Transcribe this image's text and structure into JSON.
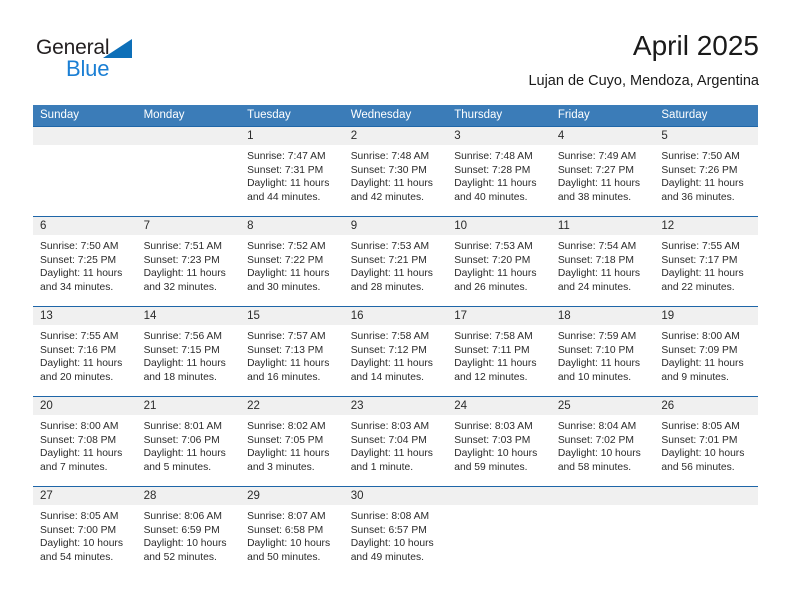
{
  "brand": {
    "name_dark": "General",
    "name_light": "Blue",
    "icon": "triangle-logo-mark",
    "color_dark": "#231f20",
    "color_light": "#1b7fd4"
  },
  "header": {
    "title": "April 2025",
    "subtitle": "Lujan de Cuyo, Mendoza, Argentina"
  },
  "theme": {
    "header_bg": "#3b7cb8",
    "header_text": "#ffffff",
    "row_rule": "#1f66a8",
    "daynum_band": "#f0f0f0",
    "body_text": "#2b2b2b"
  },
  "calendar": {
    "weekday_headers": [
      "Sunday",
      "Monday",
      "Tuesday",
      "Wednesday",
      "Thursday",
      "Friday",
      "Saturday"
    ],
    "weeks": [
      [
        {
          "day": "",
          "lines": []
        },
        {
          "day": "",
          "lines": []
        },
        {
          "day": "1",
          "lines": [
            "Sunrise: 7:47 AM",
            "Sunset: 7:31 PM",
            "Daylight: 11 hours",
            "and 44 minutes."
          ]
        },
        {
          "day": "2",
          "lines": [
            "Sunrise: 7:48 AM",
            "Sunset: 7:30 PM",
            "Daylight: 11 hours",
            "and 42 minutes."
          ]
        },
        {
          "day": "3",
          "lines": [
            "Sunrise: 7:48 AM",
            "Sunset: 7:28 PM",
            "Daylight: 11 hours",
            "and 40 minutes."
          ]
        },
        {
          "day": "4",
          "lines": [
            "Sunrise: 7:49 AM",
            "Sunset: 7:27 PM",
            "Daylight: 11 hours",
            "and 38 minutes."
          ]
        },
        {
          "day": "5",
          "lines": [
            "Sunrise: 7:50 AM",
            "Sunset: 7:26 PM",
            "Daylight: 11 hours",
            "and 36 minutes."
          ]
        }
      ],
      [
        {
          "day": "6",
          "lines": [
            "Sunrise: 7:50 AM",
            "Sunset: 7:25 PM",
            "Daylight: 11 hours",
            "and 34 minutes."
          ]
        },
        {
          "day": "7",
          "lines": [
            "Sunrise: 7:51 AM",
            "Sunset: 7:23 PM",
            "Daylight: 11 hours",
            "and 32 minutes."
          ]
        },
        {
          "day": "8",
          "lines": [
            "Sunrise: 7:52 AM",
            "Sunset: 7:22 PM",
            "Daylight: 11 hours",
            "and 30 minutes."
          ]
        },
        {
          "day": "9",
          "lines": [
            "Sunrise: 7:53 AM",
            "Sunset: 7:21 PM",
            "Daylight: 11 hours",
            "and 28 minutes."
          ]
        },
        {
          "day": "10",
          "lines": [
            "Sunrise: 7:53 AM",
            "Sunset: 7:20 PM",
            "Daylight: 11 hours",
            "and 26 minutes."
          ]
        },
        {
          "day": "11",
          "lines": [
            "Sunrise: 7:54 AM",
            "Sunset: 7:18 PM",
            "Daylight: 11 hours",
            "and 24 minutes."
          ]
        },
        {
          "day": "12",
          "lines": [
            "Sunrise: 7:55 AM",
            "Sunset: 7:17 PM",
            "Daylight: 11 hours",
            "and 22 minutes."
          ]
        }
      ],
      [
        {
          "day": "13",
          "lines": [
            "Sunrise: 7:55 AM",
            "Sunset: 7:16 PM",
            "Daylight: 11 hours",
            "and 20 minutes."
          ]
        },
        {
          "day": "14",
          "lines": [
            "Sunrise: 7:56 AM",
            "Sunset: 7:15 PM",
            "Daylight: 11 hours",
            "and 18 minutes."
          ]
        },
        {
          "day": "15",
          "lines": [
            "Sunrise: 7:57 AM",
            "Sunset: 7:13 PM",
            "Daylight: 11 hours",
            "and 16 minutes."
          ]
        },
        {
          "day": "16",
          "lines": [
            "Sunrise: 7:58 AM",
            "Sunset: 7:12 PM",
            "Daylight: 11 hours",
            "and 14 minutes."
          ]
        },
        {
          "day": "17",
          "lines": [
            "Sunrise: 7:58 AM",
            "Sunset: 7:11 PM",
            "Daylight: 11 hours",
            "and 12 minutes."
          ]
        },
        {
          "day": "18",
          "lines": [
            "Sunrise: 7:59 AM",
            "Sunset: 7:10 PM",
            "Daylight: 11 hours",
            "and 10 minutes."
          ]
        },
        {
          "day": "19",
          "lines": [
            "Sunrise: 8:00 AM",
            "Sunset: 7:09 PM",
            "Daylight: 11 hours",
            "and 9 minutes."
          ]
        }
      ],
      [
        {
          "day": "20",
          "lines": [
            "Sunrise: 8:00 AM",
            "Sunset: 7:08 PM",
            "Daylight: 11 hours",
            "and 7 minutes."
          ]
        },
        {
          "day": "21",
          "lines": [
            "Sunrise: 8:01 AM",
            "Sunset: 7:06 PM",
            "Daylight: 11 hours",
            "and 5 minutes."
          ]
        },
        {
          "day": "22",
          "lines": [
            "Sunrise: 8:02 AM",
            "Sunset: 7:05 PM",
            "Daylight: 11 hours",
            "and 3 minutes."
          ]
        },
        {
          "day": "23",
          "lines": [
            "Sunrise: 8:03 AM",
            "Sunset: 7:04 PM",
            "Daylight: 11 hours",
            "and 1 minute."
          ]
        },
        {
          "day": "24",
          "lines": [
            "Sunrise: 8:03 AM",
            "Sunset: 7:03 PM",
            "Daylight: 10 hours",
            "and 59 minutes."
          ]
        },
        {
          "day": "25",
          "lines": [
            "Sunrise: 8:04 AM",
            "Sunset: 7:02 PM",
            "Daylight: 10 hours",
            "and 58 minutes."
          ]
        },
        {
          "day": "26",
          "lines": [
            "Sunrise: 8:05 AM",
            "Sunset: 7:01 PM",
            "Daylight: 10 hours",
            "and 56 minutes."
          ]
        }
      ],
      [
        {
          "day": "27",
          "lines": [
            "Sunrise: 8:05 AM",
            "Sunset: 7:00 PM",
            "Daylight: 10 hours",
            "and 54 minutes."
          ]
        },
        {
          "day": "28",
          "lines": [
            "Sunrise: 8:06 AM",
            "Sunset: 6:59 PM",
            "Daylight: 10 hours",
            "and 52 minutes."
          ]
        },
        {
          "day": "29",
          "lines": [
            "Sunrise: 8:07 AM",
            "Sunset: 6:58 PM",
            "Daylight: 10 hours",
            "and 50 minutes."
          ]
        },
        {
          "day": "30",
          "lines": [
            "Sunrise: 8:08 AM",
            "Sunset: 6:57 PM",
            "Daylight: 10 hours",
            "and 49 minutes."
          ]
        },
        {
          "day": "",
          "lines": []
        },
        {
          "day": "",
          "lines": []
        },
        {
          "day": "",
          "lines": []
        }
      ]
    ]
  }
}
